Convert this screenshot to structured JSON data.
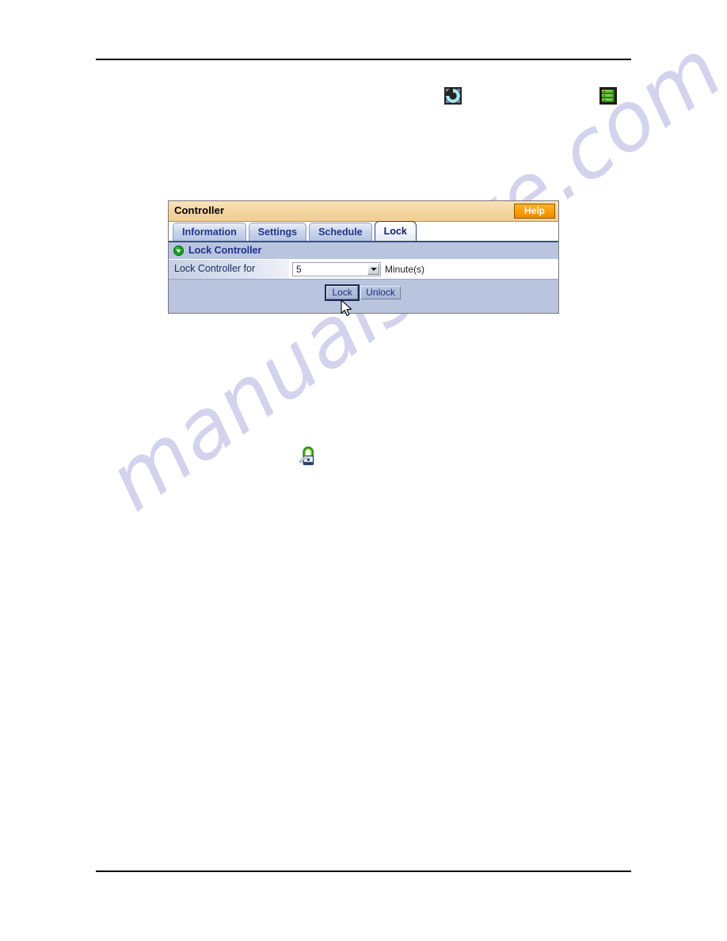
{
  "page": {
    "watermark_text": "manualshive.com",
    "watermark_color": "#d3d3ee",
    "rule_color": "#000000"
  },
  "doc_icons": [
    {
      "name": "refresh-icon",
      "label": "refresh"
    },
    {
      "name": "stacked-disks-icon",
      "label": "stacked disks"
    },
    {
      "name": "lock-icon",
      "label": "lock"
    }
  ],
  "panel": {
    "title": "Controller",
    "help_label": "Help",
    "title_bg": "#f3d49d",
    "help_bg": "#fb9b06",
    "tabs": [
      {
        "label": "Information",
        "active": false
      },
      {
        "label": "Settings",
        "active": false
      },
      {
        "label": "Schedule",
        "active": false
      },
      {
        "label": "Lock",
        "active": true
      }
    ],
    "section": {
      "title": "Lock Controller",
      "bullet_color": "#119c21",
      "title_color": "#1b2f8c"
    },
    "form": {
      "label": "Lock Controller for",
      "select_value": "5",
      "select_options": [
        "5"
      ],
      "unit": "Minute(s)"
    },
    "buttons": {
      "lock_label": "Lock",
      "unlock_label": "Unlock"
    }
  }
}
